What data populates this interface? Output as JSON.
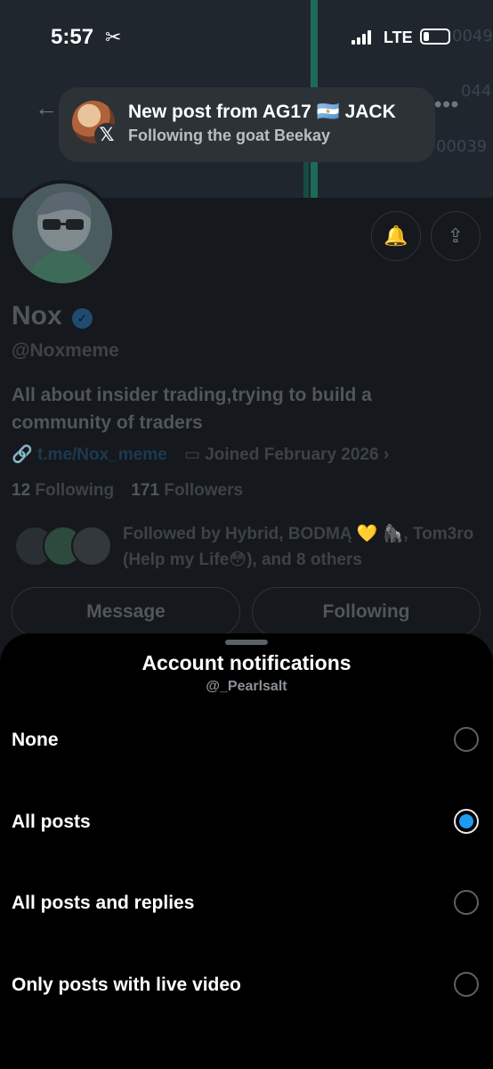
{
  "status_bar": {
    "time": "5:57",
    "network": "LTE"
  },
  "banner": {
    "price_labels": [
      "0049",
      "044",
      "00039"
    ]
  },
  "toast": {
    "title": "New post from AG17 🇦🇷 JACK",
    "subtitle": "Following the goat Beekay",
    "badge_icon": "x-logo-icon"
  },
  "profile": {
    "name": "Nox",
    "handle": "@Noxmeme",
    "bio": "All about insider trading,trying to build a community of traders",
    "link": "t.me/Nox_meme",
    "joined": "Joined February 2026",
    "following_count": "12",
    "following_label": "Following",
    "followers_count": "171",
    "followers_label": "Followers",
    "followed_by": "Followed by Hybrid, BODMĄ 💛 🦍, Tom3ro (Help my Life😳), and 8 others",
    "message_label": "Message",
    "following_button_label": "Following"
  },
  "sheet": {
    "title": "Account notifications",
    "subtitle": "@_Pearlsalt",
    "options": [
      {
        "label": "None",
        "selected": false
      },
      {
        "label": "All posts",
        "selected": true
      },
      {
        "label": "All posts and replies",
        "selected": false
      },
      {
        "label": "Only posts with live video",
        "selected": false
      }
    ]
  },
  "colors": {
    "accent": "#1d9bf0",
    "sheet_bg": "#000000",
    "dimmed_bg": "#15181c"
  }
}
